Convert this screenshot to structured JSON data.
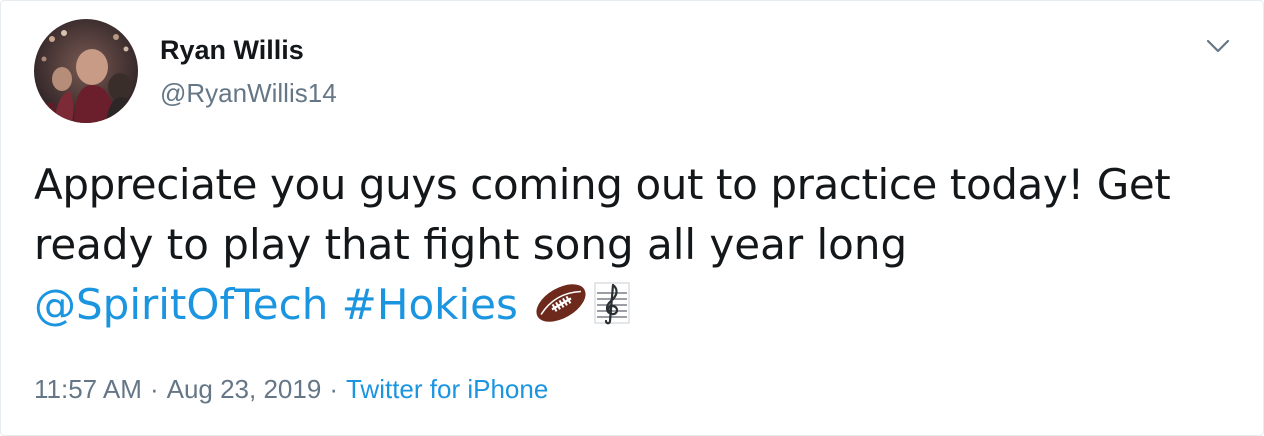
{
  "tweet": {
    "display_name": "Ryan Willis",
    "handle": "@RyanWillis14",
    "text_line1": "Appreciate you guys coming out to practice today! Get",
    "text_line2": "ready to play that fight song all year long",
    "mention": "@SpiritOfTech",
    "hashtag": "#Hokies",
    "emojis": [
      "american-football-emoji",
      "musical-score-emoji"
    ],
    "time": "11:57 AM",
    "separator": "·",
    "date": "Aug 23, 2019",
    "source": "Twitter for iPhone"
  },
  "icons": {
    "more_menu": "chevron-down-icon"
  },
  "colors": {
    "text": "#14171a",
    "secondary": "#657786",
    "link": "#1b95e0"
  }
}
